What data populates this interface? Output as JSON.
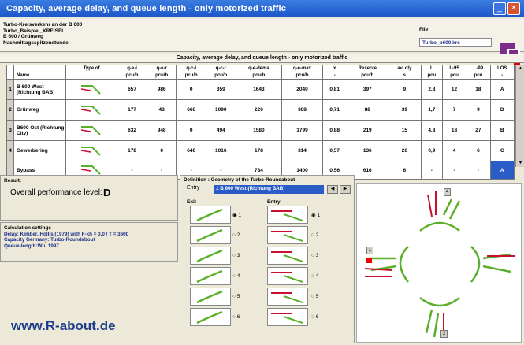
{
  "window": {
    "title": "Capacity, average delay, and queue length - only motorized traffic"
  },
  "header": {
    "lines": [
      "Turbo-Kreisverkehr an der B 600",
      "Turbo_Beispiel_KREISEL",
      "B 600 / Grünweg",
      "Nachmittagsspitzenstunde"
    ],
    "file_label": "File:",
    "file_value": "Turbo_b600.krs"
  },
  "table": {
    "title": "Capacity, average delay, and queue length - only motorized traffic",
    "headers": [
      "Name",
      "Type of",
      "q-e-i",
      "q-e-r",
      "q-c-i",
      "q-c-r",
      "q-e-dema",
      "q-e-max",
      "x",
      "Reserve",
      "av. dly",
      "L",
      "L-95",
      "L-99",
      "LOS"
    ],
    "units": [
      "",
      "",
      "pcu/h",
      "pcu/h",
      "pcu/h",
      "pcu/h",
      "pcu/h",
      "pcu/h",
      "-",
      "pcu/h",
      "s",
      "pcu",
      "pcu",
      "pcu",
      "-"
    ],
    "rows": [
      {
        "num": "1",
        "name": "B 600 West (Richtung BAB)",
        "cells": [
          "657",
          "986",
          "0",
          "359",
          "1643",
          "2040",
          "0,81",
          "397",
          "9",
          "2,8",
          "12",
          "18",
          "A"
        ]
      },
      {
        "num": "2",
        "name": "Grünweg",
        "cells": [
          "177",
          "43",
          "666",
          "1090",
          "220",
          "308",
          "0,71",
          "88",
          "39",
          "1,7",
          "7",
          "9",
          "D"
        ]
      },
      {
        "num": "3",
        "name": "B600 Ost (Richtung City)",
        "cells": [
          "632",
          "948",
          "0",
          "494",
          "1580",
          "1799",
          "0,88",
          "219",
          "15",
          "4,8",
          "18",
          "27",
          "B"
        ]
      },
      {
        "num": "4",
        "name": "Gewerbering",
        "cells": [
          "178",
          "0",
          "640",
          "1016",
          "178",
          "314",
          "0,57",
          "136",
          "26",
          "0,9",
          "4",
          "6",
          "C"
        ]
      },
      {
        "num": "",
        "name": "Bypass",
        "cells": [
          "-",
          "-",
          "-",
          "-",
          "784",
          "1400",
          "0,56",
          "616",
          "6",
          "-",
          "-",
          "-",
          "A"
        ]
      }
    ]
  },
  "result": {
    "label": "Result:",
    "overall_label": "Overall performance level:",
    "overall_value": "D"
  },
  "calc": {
    "title": "Calculation settings",
    "delay": "Delay:    Kimber, Hollis (1979) with F-kh = 0,0 / T = 3600",
    "capacity": "Capacity Germany: Turbo-Roundabout",
    "queue": "Queue-length:Wu, 1997"
  },
  "watermark": "www.R-about.de",
  "geometry": {
    "title": "Definition : Geometry of the Turbo-Roundabout",
    "entry_label": "Entry",
    "entry_value": "1  B 600 West (Richtung BAB)",
    "exit_label": "Exit",
    "entry_col_label": "Entry",
    "options": [
      "1",
      "2",
      "3",
      "4",
      "5",
      "6"
    ],
    "map_top": "4",
    "map_left": "1",
    "map_bottom": "2"
  }
}
